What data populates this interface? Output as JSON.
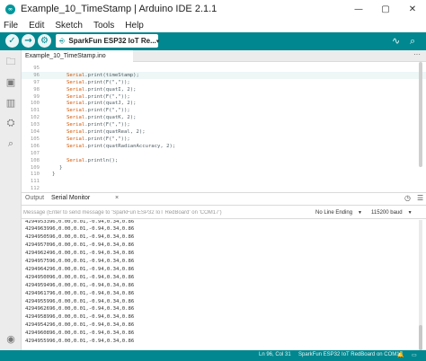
{
  "window": {
    "title": "Example_10_TimeStamp | Arduino IDE 2.1.1",
    "minimize": "—",
    "maximize": "▢",
    "close": "✕"
  },
  "menu": [
    "File",
    "Edit",
    "Sketch",
    "Tools",
    "Help"
  ],
  "toolbar": {
    "board": "SparkFun ESP32 IoT Re...",
    "verify_icon": "✓",
    "upload_icon": "→",
    "debug_icon": "⚙",
    "plotter_icon": "∿",
    "monitor_icon": "⌕"
  },
  "editor": {
    "file_tab": "Example_10_TimeStamp.ino",
    "more": "···",
    "lines": [
      {
        "num": "95",
        "code": ""
      },
      {
        "num": "96",
        "code": "Serial.print(timeStamp);"
      },
      {
        "num": "97",
        "code": "Serial.print(F(\",\"));"
      },
      {
        "num": "98",
        "code": "Serial.print(quatI, 2);"
      },
      {
        "num": "99",
        "code": "Serial.print(F(\",\"));"
      },
      {
        "num": "100",
        "code": "Serial.print(quatJ, 2);"
      },
      {
        "num": "101",
        "code": "Serial.print(F(\",\"));"
      },
      {
        "num": "102",
        "code": "Serial.print(quatK, 2);"
      },
      {
        "num": "103",
        "code": "Serial.print(F(\",\"));"
      },
      {
        "num": "104",
        "code": "Serial.print(quatReal, 2);"
      },
      {
        "num": "105",
        "code": "Serial.print(F(\",\"));"
      },
      {
        "num": "106",
        "code": "Serial.print(quatRadianAccuracy, 2);"
      },
      {
        "num": "107",
        "code": ""
      },
      {
        "num": "108",
        "code": "Serial.println();"
      },
      {
        "num": "109",
        "code": "}"
      },
      {
        "num": "110",
        "code": "}"
      },
      {
        "num": "111",
        "code": ""
      },
      {
        "num": "112",
        "code": ""
      }
    ]
  },
  "panel": {
    "tab_output": "Output",
    "tab_serial": "Serial Monitor",
    "close": "×",
    "input_placeholder": "Message (Enter to send message to 'SparkFun ESP32 IoT RedBoard' on 'COM17')",
    "line_ending": "No Line Ending",
    "baud": "115200 baud",
    "output_lines": [
      "4294953396,0.00,0.01,-0.94,0.34,0.86",
      "4294963996,0.00,0.01,-0.94,0.34,0.86",
      "4294950596,0.00,0.01,-0.94,0.34,0.86",
      "4294957096,0.00,0.01,-0.94,0.34,0.86",
      "4294962496,0.00,0.01,-0.94,0.34,0.86",
      "4294957596,0.00,0.01,-0.94,0.34,0.86",
      "4294964296,0.00,0.01,-0.94,0.34,0.86",
      "4294950096,0.00,0.01,-0.94,0.34,0.86",
      "4294959496,0.00,0.01,-0.94,0.34,0.86",
      "4294961796,0.00,0.01,-0.94,0.34,0.86",
      "4294955996,0.00,0.01,-0.94,0.34,0.86",
      "4294962696,0.00,0.01,-0.94,0.34,0.86",
      "4294958996,0.00,0.01,-0.94,0.34,0.86",
      "4294954296,0.00,0.01,-0.94,0.34,0.86",
      "4294960896,0.00,0.01,-0.94,0.34,0.86",
      "4294955996,0.00,0.01,-0.94,0.34,0.86"
    ]
  },
  "status": {
    "cursor": "Ln 96, Col 31",
    "board": "SparkFun ESP32 IoT RedBoard on COM17",
    "notifications": "🔔",
    "layout": "▭"
  },
  "colors": {
    "accent": "#00878f",
    "keyword": "#d35400"
  }
}
